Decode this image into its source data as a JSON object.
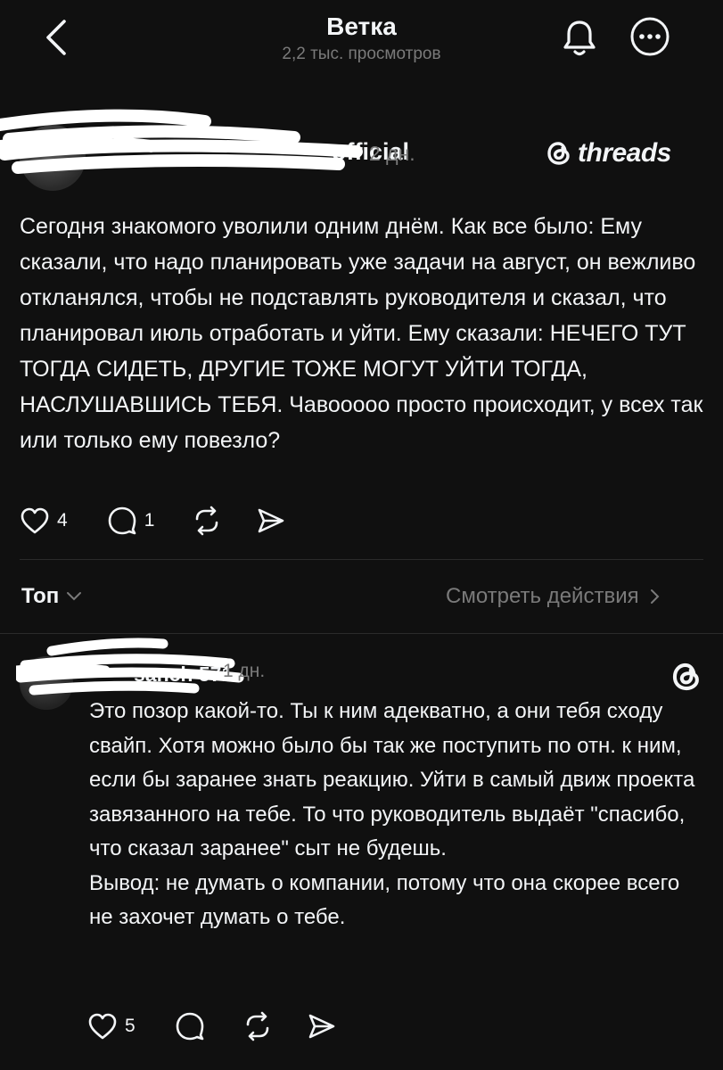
{
  "header": {
    "back_icon": "chevron-left-icon",
    "title": "Ветка",
    "subtitle": "2,2 тыс. просмотров",
    "bell_icon": "bell-icon",
    "more_icon": "more-horizontal-icon"
  },
  "post": {
    "author": "official",
    "time": "2 дн.",
    "brand": "threads",
    "text": "Сегодня знакомого уволили одним днём. Как все было: Ему сказали, что надо планировать уже задачи на август, он вежливо откланялся, чтобы не подставлять руководителя и сказал, что планировал июль отработать и уйти. Ему сказали: НЕЧЕГО ТУТ ТОГДА СИДЕТЬ, ДРУГИЕ ТОЖЕ МОГУТ УЙТИ ТОГДА, НАСЛУШАВШИСЬ ТЕБЯ. Чавооооо просто происходит, у всех так или только ему повезло?",
    "likes": "4",
    "comments": "1"
  },
  "controls": {
    "sort_label": "Топ",
    "activity_label": "Смотреть действия"
  },
  "reply": {
    "author": "sanch 571",
    "time": "1 дн.",
    "paragraph1": "Это позор какой-то. Ты к ним адекватно, а они тебя сходу свайп. Хотя можно было бы так же поступить по отн. к ним, если бы заранее знать реакцию. Уйти в самый движ проекта завязанного на тебе. То что руководитель выдаёт \"спасибо, что сказал заранее\" сыт не будешь.",
    "paragraph2": "Вывод: не думать о компании, потому что она скорее всего не захочет думать о тебе.",
    "likes": "5"
  },
  "colors": {
    "background": "#101010",
    "text": "#f3f5f7",
    "muted": "#7a7a7a",
    "divider": "#2b2b2b"
  }
}
